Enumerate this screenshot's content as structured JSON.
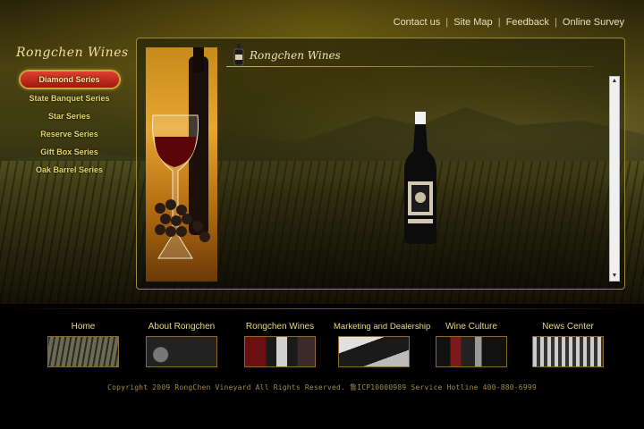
{
  "header": {
    "links": [
      {
        "label": "Contact us"
      },
      {
        "label": "Site Map"
      },
      {
        "label": "Feedback"
      },
      {
        "label": "Online Survey"
      }
    ],
    "separator": "|"
  },
  "sidebar": {
    "brand": "Rongchen Wines",
    "items": [
      {
        "label": "Diamond Series",
        "active": true
      },
      {
        "label": "State Banquet Series"
      },
      {
        "label": "Star Series"
      },
      {
        "label": "Reserve Series"
      },
      {
        "label": "Gift Box Series"
      },
      {
        "label": "Oak Barrel Series"
      }
    ]
  },
  "panel": {
    "title": "Rongchen Wines",
    "scroll_up_icon": "arrow-up-icon",
    "scroll_down_icon": "arrow-down-icon"
  },
  "nav": [
    {
      "label": "Home",
      "thumb": "vineyard-rows"
    },
    {
      "label": "About Rongchen",
      "thumb": "barrels"
    },
    {
      "label": "Rongchen Wines",
      "thumb": "wine-bottle"
    },
    {
      "label": "Marketing and Dealership",
      "thumb": "bottle-on-side"
    },
    {
      "label": "Wine Culture",
      "thumb": "wine-glasses"
    },
    {
      "label": "News Center",
      "thumb": "wine-rack"
    }
  ],
  "footer": {
    "text": "Copyright 2009 RongChen Vineyard All Rights Reserved. 鲁ICP10000989  Service Hotline 400-880-6999"
  },
  "colors": {
    "accent_gold": "#e6d46a",
    "active_red": "#c0281a",
    "panel_border": "#9c8a3a"
  }
}
